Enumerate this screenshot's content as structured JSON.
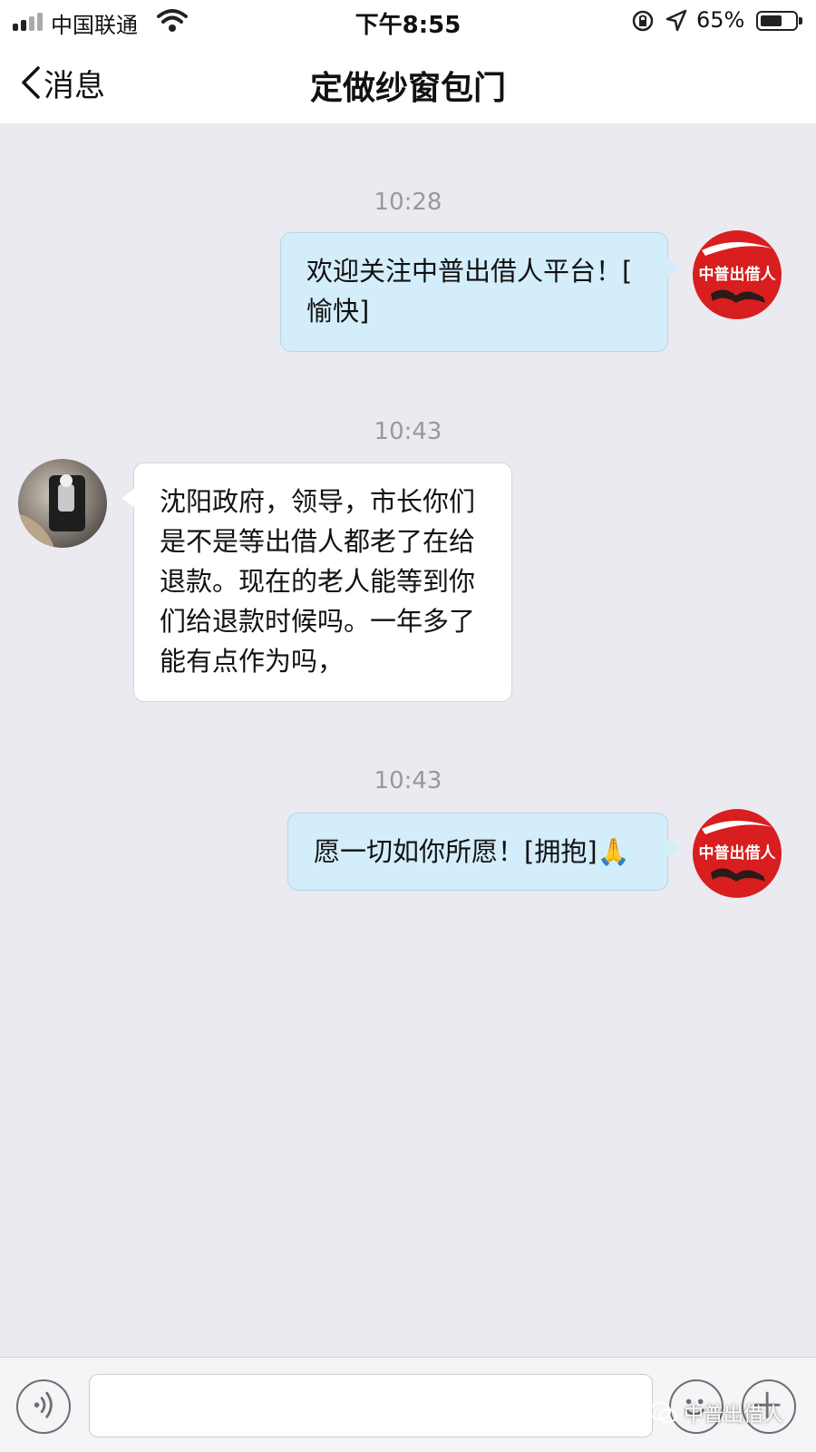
{
  "status_bar": {
    "carrier": "中国联通",
    "time": "下午8:55",
    "battery_percent": "65%",
    "battery_level": 0.65,
    "icons": [
      "signal-icon",
      "wifi-icon",
      "rotation-lock-icon",
      "location-icon",
      "battery-icon"
    ]
  },
  "nav": {
    "back_label": "消息",
    "title": "定做纱窗包门"
  },
  "messages": [
    {
      "timestamp": "10:28",
      "direction": "outgoing",
      "lines": [
        "欢迎关注中普出借人平台！[",
        "愉快]"
      ]
    },
    {
      "timestamp": "10:43",
      "direction": "incoming",
      "lines": [
        "沈阳政府，领导，市长你们",
        "是不是等出借人都老了在给",
        "退款。现在的老人能等到你",
        "们给退款时候吗。一年多了",
        "能有点作为吗，"
      ]
    },
    {
      "timestamp": "10:43",
      "direction": "outgoing",
      "lines": [
        "愿一切如你所愿！[拥抱]🙏"
      ]
    }
  ],
  "avatar_logo_text": "中普出借人",
  "input_bar": {
    "icons": [
      "voice-icon",
      "emoji-icon",
      "plus-icon"
    ]
  },
  "watermark": {
    "text": "中普出借人"
  },
  "colors": {
    "chat_background": "#ebeaf0",
    "outgoing_bubble": "#d3edfb",
    "incoming_bubble": "#ffffff",
    "brand_red": "#d81e1e"
  }
}
